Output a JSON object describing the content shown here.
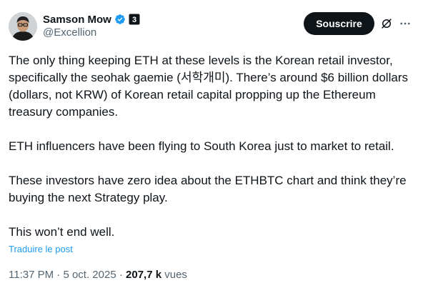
{
  "author": {
    "name": "Samson Mow",
    "handle": "@Excellion",
    "verified_color": "#1d9bf0",
    "affiliate_glyph": "3"
  },
  "actions": {
    "subscribe_label": "Souscrire",
    "grok_icon": "grok-icon",
    "more_icon": "more-icon"
  },
  "tweet": {
    "paragraphs": [
      "The only thing keeping ETH at these levels is the Korean retail investor, specifically the seohak gaemie (서학개미). There’s around $6 billion dollars (dollars, not KRW) of Korean retail capital propping up the Ethereum treasury companies.",
      "ETH influencers have been flying to South Korea just to market to retail.",
      "These investors have zero idea about the ETHBTC chart and think they’re buying the next Strategy play.",
      "This won’t end well."
    ],
    "translate_label": "Traduire le post"
  },
  "meta": {
    "time": "11:37 PM",
    "separator": "·",
    "date": "5 oct. 2025",
    "views_count": "207,7 k",
    "views_label": "vues"
  }
}
